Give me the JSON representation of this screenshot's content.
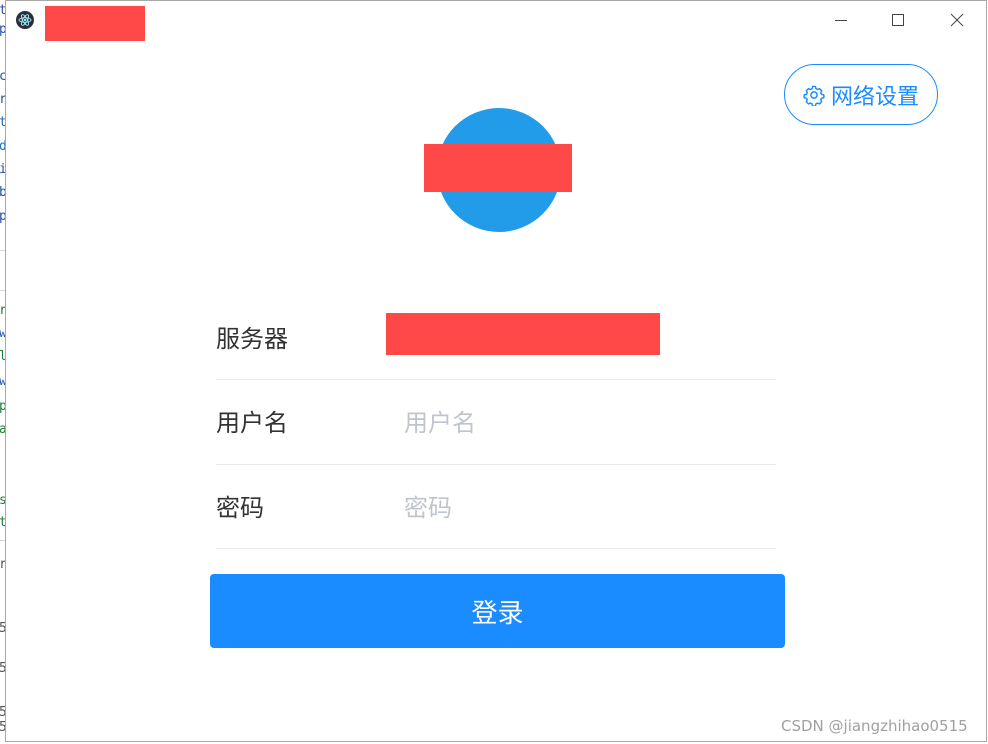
{
  "colors": {
    "accent": "#1a8cff",
    "logo_circle": "#229be8",
    "redaction": "#ff4848",
    "placeholder": "#c0c4cc",
    "label": "#333333",
    "divider": "#ebebeb"
  },
  "background_editor": {
    "chars": [
      "t",
      "p",
      "c",
      "r",
      "t",
      "d",
      "i",
      "b",
      "p",
      "r",
      "w",
      "l",
      "w",
      "p",
      "a",
      "s",
      "t",
      "r",
      "5",
      "5",
      "5",
      "5"
    ],
    "colors": [
      "#2b50a8",
      "#2b50a8",
      "#2b50a8",
      "#2b50a8",
      "#1b6fb5",
      "#1b6fb5",
      "#2b50a8",
      "#2b50a8",
      "#2b50a8",
      "#1e7f3a",
      "#2b50a8",
      "#1e7f3a",
      "#2b50a8",
      "#1e7f3a",
      "#1e7f3a",
      "#1e7f3a",
      "#1e7f3a",
      "#555555",
      "#555555",
      "#555555",
      "#555555",
      "#555555"
    ]
  },
  "window": {
    "title_redacted": true,
    "controls": {
      "minimize_icon": "minimize-icon",
      "maximize_icon": "maximize-icon",
      "close_icon": "close-icon"
    }
  },
  "network_settings": {
    "icon": "gear-icon",
    "label": "网络设置"
  },
  "form": {
    "server": {
      "label": "服务器",
      "value_redacted": true
    },
    "username": {
      "label": "用户名",
      "placeholder": "用户名",
      "value": ""
    },
    "password": {
      "label": "密码",
      "placeholder": "密码",
      "value": ""
    }
  },
  "login_button": {
    "label": "登录"
  },
  "watermark": "CSDN @jiangzhihao0515"
}
